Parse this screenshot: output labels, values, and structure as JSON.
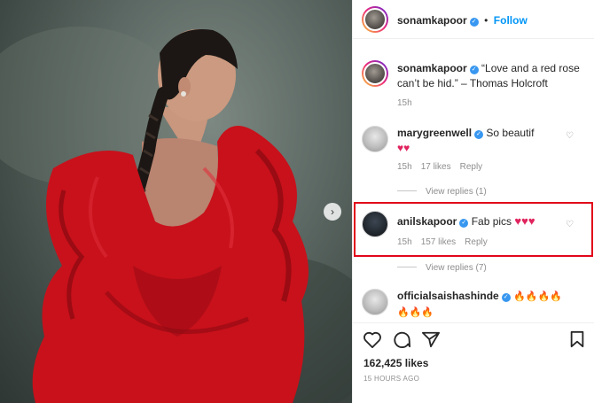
{
  "post": {
    "next_arrow": "›"
  },
  "header": {
    "username": "sonamkapoor",
    "follow_label": "Follow",
    "bullet": "•"
  },
  "caption": {
    "username": "sonamkapoor",
    "line1": "“Love and a red rose",
    "line2": "can’t be hid.” – Thomas Holcroft",
    "time": "15h"
  },
  "comments": [
    {
      "username": "marygreenwell",
      "text": "So beautif",
      "text2": "♥♥",
      "time": "15h",
      "likes": "17 likes",
      "reply": "Reply",
      "view_replies": "View replies (1)"
    },
    {
      "username": "anilskapoor",
      "text": "Fab pics",
      "hearts": "♥♥♥",
      "time": "15h",
      "likes": "157 likes",
      "reply": "Reply",
      "view_replies": "View replies (7)"
    },
    {
      "username": "officialsaishashinde",
      "fire1": "🔥🔥🔥🔥",
      "fire2": "🔥🔥🔥"
    }
  ],
  "footer": {
    "likes": "162,425 likes",
    "timestamp": "15 HOURS AGO"
  },
  "colors": {
    "dress_red": "#c8111b",
    "highlight_border": "#e1061a",
    "verified_blue": "#3897f0",
    "follow_blue": "#0095f6"
  },
  "icons": [
    "heart-icon",
    "comment-icon",
    "share-icon",
    "bookmark-icon",
    "verified-icon",
    "chevron-right-icon"
  ]
}
